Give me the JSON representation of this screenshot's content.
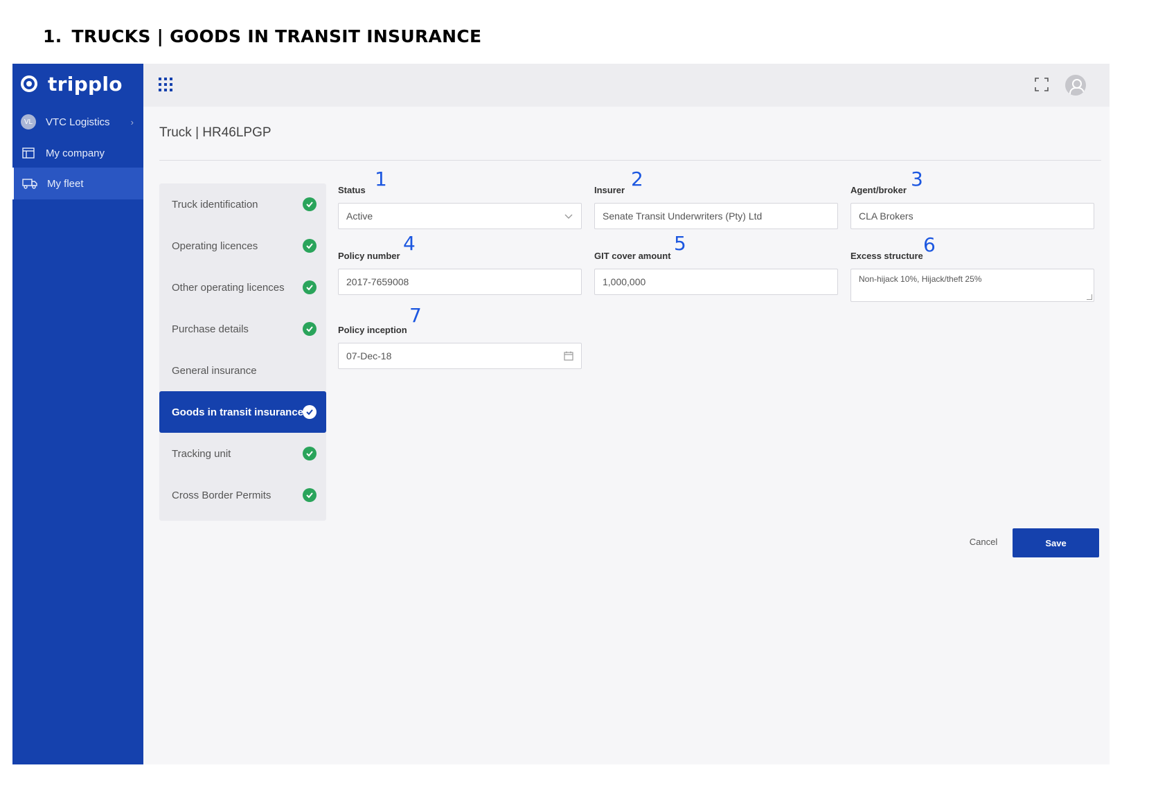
{
  "doc_heading": {
    "number": "1.",
    "text": "TRUCKS | GOODS IN TRANSIT INSURANCE"
  },
  "brand": {
    "name": "tripplo"
  },
  "sidebar": {
    "org": {
      "initials": "VL",
      "label": "VTC Logistics"
    },
    "items": [
      {
        "label": "My company",
        "icon": "building-icon"
      },
      {
        "label": "My fleet",
        "icon": "truck-icon",
        "active": true
      }
    ]
  },
  "topbar": {
    "icons": [
      "apps-grid-icon",
      "expand-icon",
      "user-avatar-icon"
    ]
  },
  "page": {
    "title": "Truck | HR46LPGP"
  },
  "steps": [
    {
      "label": "Truck identification",
      "complete": true
    },
    {
      "label": "Operating licences",
      "complete": true
    },
    {
      "label": "Other operating licences",
      "complete": true
    },
    {
      "label": "Purchase details",
      "complete": true
    },
    {
      "label": "General insurance",
      "complete": false
    },
    {
      "label": "Goods in transit insurance",
      "complete": true,
      "active": true
    },
    {
      "label": "Tracking unit",
      "complete": true
    },
    {
      "label": "Cross Border Permits",
      "complete": true
    }
  ],
  "form": {
    "status": {
      "label": "Status",
      "value": "Active",
      "marker": "1"
    },
    "insurer": {
      "label": "Insurer",
      "value": "Senate Transit Underwriters (Pty) Ltd",
      "marker": "2"
    },
    "agent": {
      "label": "Agent/broker",
      "value": "CLA Brokers",
      "marker": "3"
    },
    "policy_number": {
      "label": "Policy number",
      "value": "2017-7659008",
      "marker": "4"
    },
    "git_cover": {
      "label": "GIT cover amount",
      "value": "1,000,000",
      "marker": "5"
    },
    "excess": {
      "label": "Excess structure",
      "value": "Non-hijack 10%, Hijack/theft 25%",
      "marker": "6"
    },
    "inception": {
      "label": "Policy inception",
      "value": "07-Dec-18",
      "marker": "7"
    }
  },
  "actions": {
    "cancel": "Cancel",
    "save": "Save"
  },
  "colors": {
    "brand_blue": "#1541ad",
    "check_green": "#2aa45b",
    "marker_blue": "#1c57e0"
  }
}
